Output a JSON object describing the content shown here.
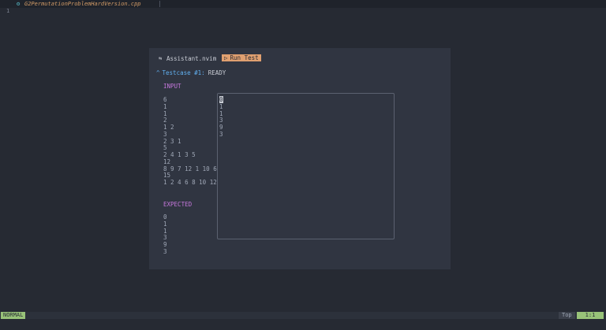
{
  "tab": {
    "icon": "gear-icon",
    "icon_glyph": "⚙",
    "filename": "G2PermutationProblemHardVersion.cpp"
  },
  "editor": {
    "line_number": "1"
  },
  "panel": {
    "plugin_icon_glyph": "⇆",
    "plugin_name": "Assistant.nvim",
    "run_button": {
      "icon_glyph": "▷",
      "label": "Run Test"
    },
    "testcase": {
      "chevron": "^",
      "label": "Testcase #1:",
      "status": "READY"
    },
    "input_header": "INPUT",
    "input_lines": [
      "6",
      "1",
      "1",
      "2",
      "1 2",
      "3",
      "2 3 1",
      "5",
      "2 4 1 3 5",
      "12",
      "8 9 7 12 1 10 6",
      "15",
      "1 2 4 6 8 10 12"
    ],
    "expected_header": "EXPECTED",
    "expected_lines": [
      "0",
      "1",
      "1",
      "3",
      "9",
      "3"
    ],
    "output_lines": [
      "0",
      "1",
      "1",
      "3",
      "9",
      "3"
    ]
  },
  "statusbar": {
    "mode": "NORMAL",
    "scroll": "Top",
    "cursor": "1:1"
  },
  "colors": {
    "mode_bg": "#98c379",
    "run_button_bg": "#e0a070",
    "section_header": "#c678dd",
    "testcase": "#61afef",
    "filename": "#d19a66"
  }
}
